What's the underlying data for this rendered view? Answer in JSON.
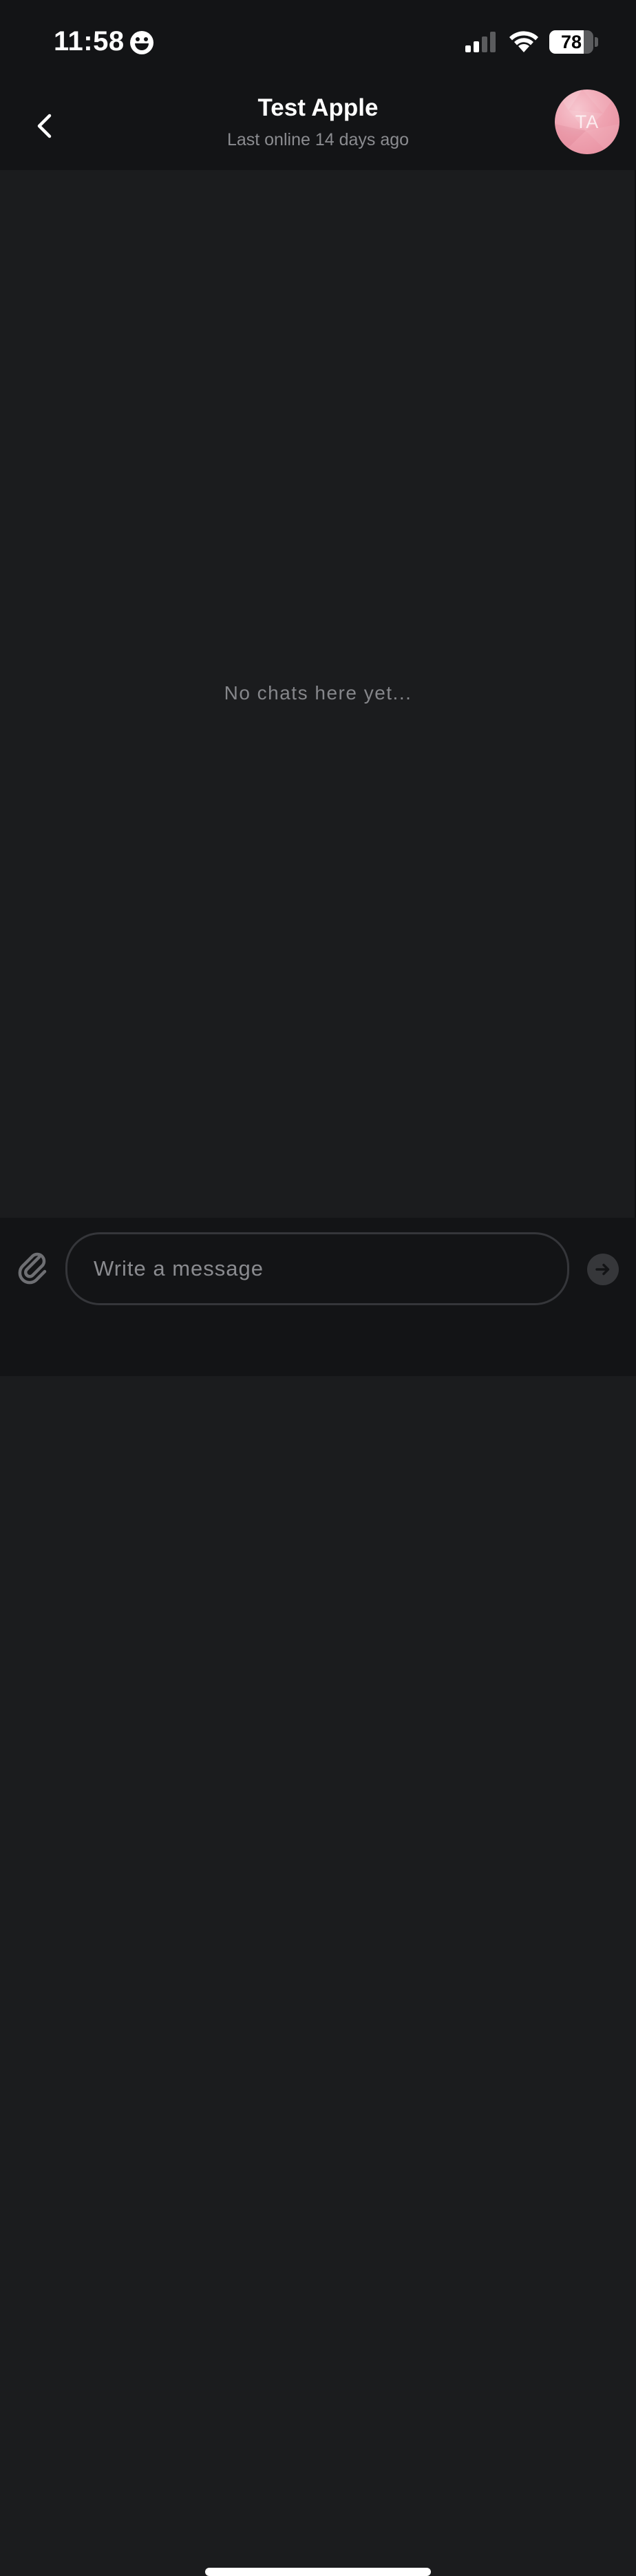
{
  "status_bar": {
    "time": "11:58",
    "status_icon": "smiley-face-icon",
    "signal_icon": "cellular-signal-icon",
    "wifi_icon": "wifi-icon",
    "battery_level": "78",
    "battery_fraction": 0.78
  },
  "header": {
    "back_icon": "chevron-left-icon",
    "contact_name": "Test Apple",
    "last_online": "Last online 14 days ago",
    "avatar_initials": "TA",
    "avatar_color": "#f0a7b4"
  },
  "chat": {
    "empty_message": "No chats here yet..."
  },
  "composer": {
    "attach_icon": "paperclip-icon",
    "placeholder": "Write a message",
    "value": "",
    "send_icon": "arrow-right-icon"
  },
  "colors": {
    "background": "#1b1c1e",
    "bars": "#131416",
    "muted_text": "#8b8c90"
  }
}
